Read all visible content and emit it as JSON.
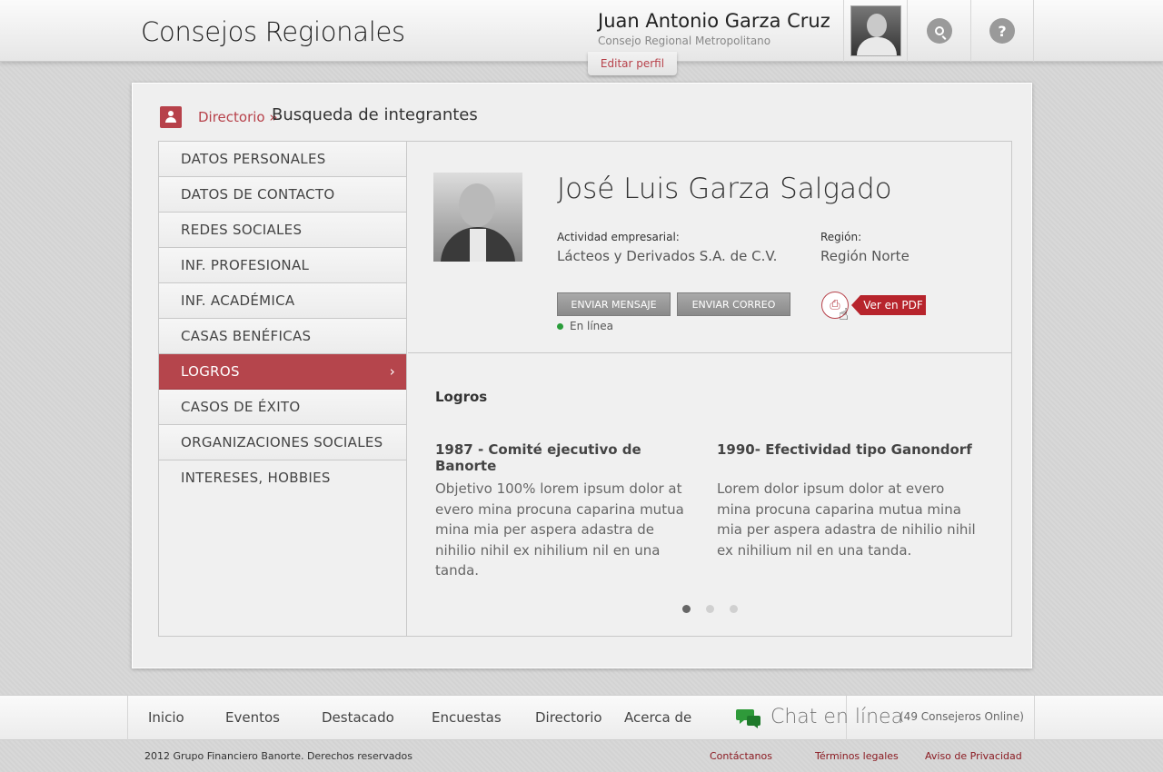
{
  "header": {
    "app_title": "Consejos Regionales",
    "user_name": "Juan Antonio Garza Cruz",
    "user_council": "Consejo Regional Metropolitano",
    "edit_profile": "Editar perfil",
    "help_label": "?"
  },
  "breadcrumb": {
    "link": "Directorio",
    "separator": "»",
    "current": "Busqueda de integrantes"
  },
  "menu": {
    "items": [
      {
        "label": "DATOS PERSONALES"
      },
      {
        "label": "DATOS DE CONTACTO"
      },
      {
        "label": "REDES SOCIALES"
      },
      {
        "label": "INF. PROFESIONAL"
      },
      {
        "label": "INF. ACADÉMICA"
      },
      {
        "label": "CASAS BENÉFICAS"
      },
      {
        "label": "LOGROS",
        "active": true
      },
      {
        "label": "CASOS DE ÉXITO"
      },
      {
        "label": "ORGANIZACIONES SOCIALES"
      },
      {
        "label": "INTERESES, HOBBIES"
      }
    ],
    "active_chevron": "›"
  },
  "profile": {
    "name": "José Luis Garza Salgado",
    "activity_label": "Actividad empresarial:",
    "activity_value": "Lácteos y Derivados S.A. de C.V.",
    "region_label": "Región:",
    "region_value": "Región Norte",
    "send_message": "ENVIAR MENSAJE",
    "send_email": "ENVIAR CORREO",
    "status": "En línea",
    "pdf_label": "Ver en PDF",
    "status_color": "#2a9d3b"
  },
  "achievements": {
    "title": "Logros",
    "items": [
      {
        "heading": "1987 - Comité ejecutivo de Banorte",
        "body": "Objetivo 100% lorem ipsum dolor at evero mina procuna caparina mutua mina mia per aspera adastra de nihilio nihil ex nihilium nil en una tanda."
      },
      {
        "heading": "1990- Efectividad tipo Ganondorf",
        "body": "Lorem dolor ipsum dolor at evero mina procuna caparina mutua mina mia per aspera adastra de nihilio nihil ex nihilium nil en una tanda."
      }
    ],
    "current_page": 1,
    "total_pages": 3
  },
  "footer": {
    "nav": [
      "Inicio",
      "Eventos",
      "Destacado",
      "Encuestas",
      "Directorio",
      "Acerca de"
    ],
    "chat_label": "Chat en línea",
    "chat_count": "(49 Consejeros Online)",
    "copyright": "2012 Grupo Financiero Banorte. Derechos reservados",
    "links": [
      "Contáctanos",
      "Términos legales",
      "Aviso de Privacidad"
    ]
  },
  "colors": {
    "accent": "#b7414a",
    "active_menu": "#b5454c",
    "pdf_tag": "#b7242c",
    "chat_icon": "#2f9a3a"
  },
  "icons": {
    "breadcrumb": "contacts-book-icon",
    "search": "search-icon",
    "help": "help-icon",
    "pdf": "pdf-icon",
    "cursor": "hand-cursor-icon",
    "chat": "chat-bubbles-icon",
    "online": "online-status-dot"
  }
}
